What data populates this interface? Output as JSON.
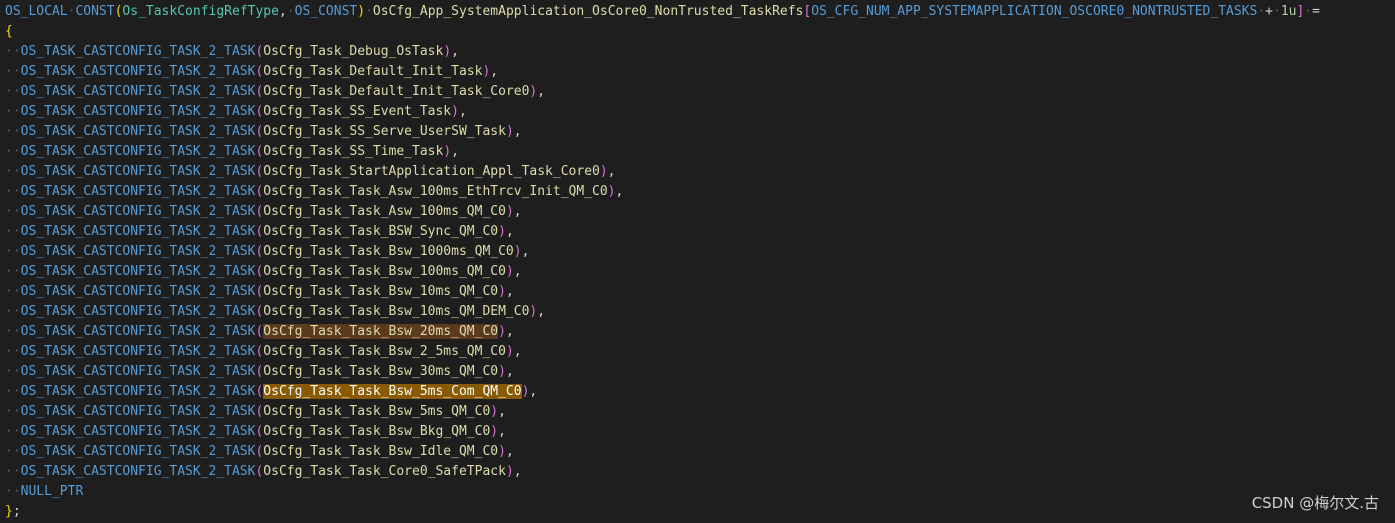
{
  "editor": {
    "line1": {
      "storage": "OS_LOCAL",
      "const_macro": "CONST",
      "type_arg": "Os_TaskConfigRefType",
      "const_arg": "OS_CONST",
      "array_name": "OsCfg_App_SystemApplication_OsCore0_NonTrusted_TaskRefs",
      "size_macro": "OS_CFG_NUM_APP_SYSTEMAPPLICATION_OSCORE0_NONTRUSTED_TASKS",
      "plus": "+",
      "one": "1u",
      "assign": "="
    },
    "open_brace": "{",
    "cast_macro": "OS_TASK_CASTCONFIG_TASK_2_TASK",
    "entries": [
      "OsCfg_Task_Debug_OsTask",
      "OsCfg_Task_Default_Init_Task",
      "OsCfg_Task_Default_Init_Task_Core0",
      "OsCfg_Task_SS_Event_Task",
      "OsCfg_Task_SS_Serve_UserSW_Task",
      "OsCfg_Task_SS_Time_Task",
      "OsCfg_Task_StartApplication_Appl_Task_Core0",
      "OsCfg_Task_Task_Asw_100ms_EthTrcv_Init_QM_C0",
      "OsCfg_Task_Task_Asw_100ms_QM_C0",
      "OsCfg_Task_Task_BSW_Sync_QM_C0",
      "OsCfg_Task_Task_Bsw_1000ms_QM_C0",
      "OsCfg_Task_Task_Bsw_100ms_QM_C0",
      "OsCfg_Task_Task_Bsw_10ms_QM_C0",
      "OsCfg_Task_Task_Bsw_10ms_QM_DEM_C0",
      "OsCfg_Task_Task_Bsw_20ms_QM_C0",
      "OsCfg_Task_Task_Bsw_2_5ms_QM_C0",
      "OsCfg_Task_Task_Bsw_30ms_QM_C0",
      "OsCfg_Task_Task_Bsw_5ms_Com_QM_C0",
      "OsCfg_Task_Task_Bsw_5ms_QM_C0",
      "OsCfg_Task_Task_Bsw_Bkg_QM_C0",
      "OsCfg_Task_Task_Bsw_Idle_QM_C0",
      "OsCfg_Task_Task_Core0_SafeTPack"
    ],
    "match_highlight_index": 14,
    "selection_highlight_index": 17,
    "null_entry": "NULL_PTR",
    "close": "};"
  },
  "watermark": "CSDN @梅尔文.古"
}
